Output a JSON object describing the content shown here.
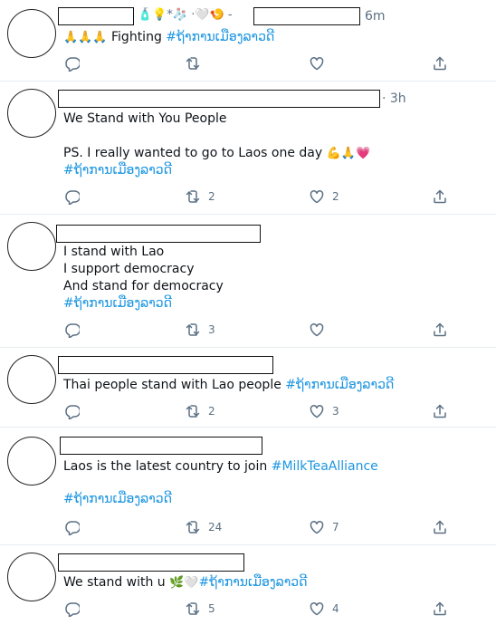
{
  "tweets": [
    {
      "time": "6m",
      "name_emojis": "🧴💡*🧦 ·🤍🍤 -",
      "lines": [
        {
          "prefix": "🙏🙏🙏",
          "text": " Fighting ",
          "hashtag": "#ຖ້າການເມືອງລາວດີ"
        }
      ],
      "counts": {
        "reply": "",
        "retweet": "",
        "like": ""
      }
    },
    {
      "time": "· 3h",
      "lines": [
        {
          "text": "We Stand with You People"
        },
        {
          "text": ""
        },
        {
          "text": "PS. I really wanted to go to Laos one day ",
          "suffix": "💪🙏💗"
        },
        {
          "hashtag": "#ຖ້າການເມືອງລາວດີ"
        }
      ],
      "counts": {
        "reply": "",
        "retweet": "2",
        "like": "2"
      }
    },
    {
      "lines": [
        {
          "text": "I stand with Lao"
        },
        {
          "text": "I support democracy"
        },
        {
          "text": "And stand for democracy"
        },
        {
          "hashtag": "#ຖ້າການເມືອງລາວດີ"
        }
      ],
      "counts": {
        "reply": "",
        "retweet": "3",
        "like": ""
      }
    },
    {
      "lines": [
        {
          "text": "Thai people stand with Lao people ",
          "hashtag": "#ຖ້າການເມືອງລາວດີ"
        }
      ],
      "counts": {
        "reply": "",
        "retweet": "2",
        "like": "3"
      }
    },
    {
      "lines": [
        {
          "text": "Laos is the latest country to join ",
          "hashtag": "#MilkTeaAlliance"
        },
        {
          "text": ""
        },
        {
          "hashtag": "#ຖ້າການເມືອງລາວດີ"
        }
      ],
      "counts": {
        "reply": "",
        "retweet": "24",
        "like": "7"
      }
    },
    {
      "lines": [
        {
          "text": "We stand with u ",
          "suffix": "🌿🤍",
          "hashtag": "#ຖ້າການເມືອງລາວດີ"
        }
      ],
      "counts": {
        "reply": "",
        "retweet": "5",
        "like": "4"
      }
    }
  ],
  "colors": {
    "hashtag": "#1b95e0",
    "icon": "#5b7083",
    "divider": "#e6ecf0"
  },
  "icons": [
    "reply-icon",
    "retweet-icon",
    "like-icon",
    "share-icon"
  ]
}
